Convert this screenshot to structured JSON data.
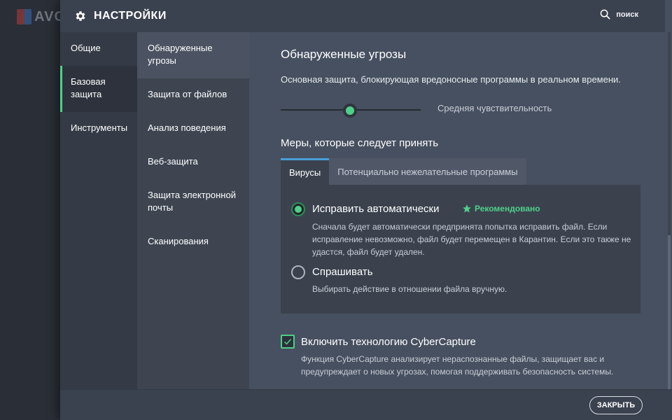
{
  "background_app": {
    "logo_text": "AVG"
  },
  "header": {
    "title": "НАСТРОЙКИ",
    "search_label": "поиск"
  },
  "nav_primary": [
    {
      "label": "Общие",
      "active": false
    },
    {
      "label": "Базовая защита",
      "active": true
    },
    {
      "label": "Инструменты",
      "active": false
    }
  ],
  "nav_secondary": [
    {
      "label": "Обнаруженные угрозы",
      "active": true
    },
    {
      "label": "Защита от файлов",
      "active": false
    },
    {
      "label": "Анализ поведения",
      "active": false
    },
    {
      "label": "Веб-защита",
      "active": false
    },
    {
      "label": "Защита электронной почты",
      "active": false
    },
    {
      "label": "Сканирования",
      "active": false
    }
  ],
  "main": {
    "title": "Обнаруженные угрозы",
    "description": "Основная защита, блокирующая вредоносные программы в реальном времени.",
    "sensitivity": {
      "label": "Средняя чувствительность",
      "level": 0.5
    },
    "actions_title": "Меры, которые следует принять",
    "tabs": [
      {
        "label": "Вирусы",
        "active": true
      },
      {
        "label": "Потенциально нежелательные программы",
        "active": false
      }
    ],
    "options": [
      {
        "title": "Исправить автоматически",
        "badge": "Рекомендовано",
        "description": "Сначала будет автоматически предпринята попытка исправить файл. Если исправление невозможно, файл будет перемещен в Карантин. Если это также не удастся, файл будет удален.",
        "selected": true
      },
      {
        "title": "Спрашивать",
        "description": "Выбирать действие в отношении файла вручную.",
        "selected": false
      }
    ],
    "cybercapture": {
      "title": "Включить технологию CyberCapture",
      "description": "Функция CyberCapture анализирует нераспознанные файлы, защищает вас и предупреждает о новых угрозах, помогая поддерживать безопасность системы.",
      "checked": true
    }
  },
  "footer": {
    "close_label": "ЗАКРЫТЬ"
  },
  "colors": {
    "accent": "#4fd08a",
    "tab_accent": "#4a9ed8",
    "dialog_bg": "#475060"
  }
}
